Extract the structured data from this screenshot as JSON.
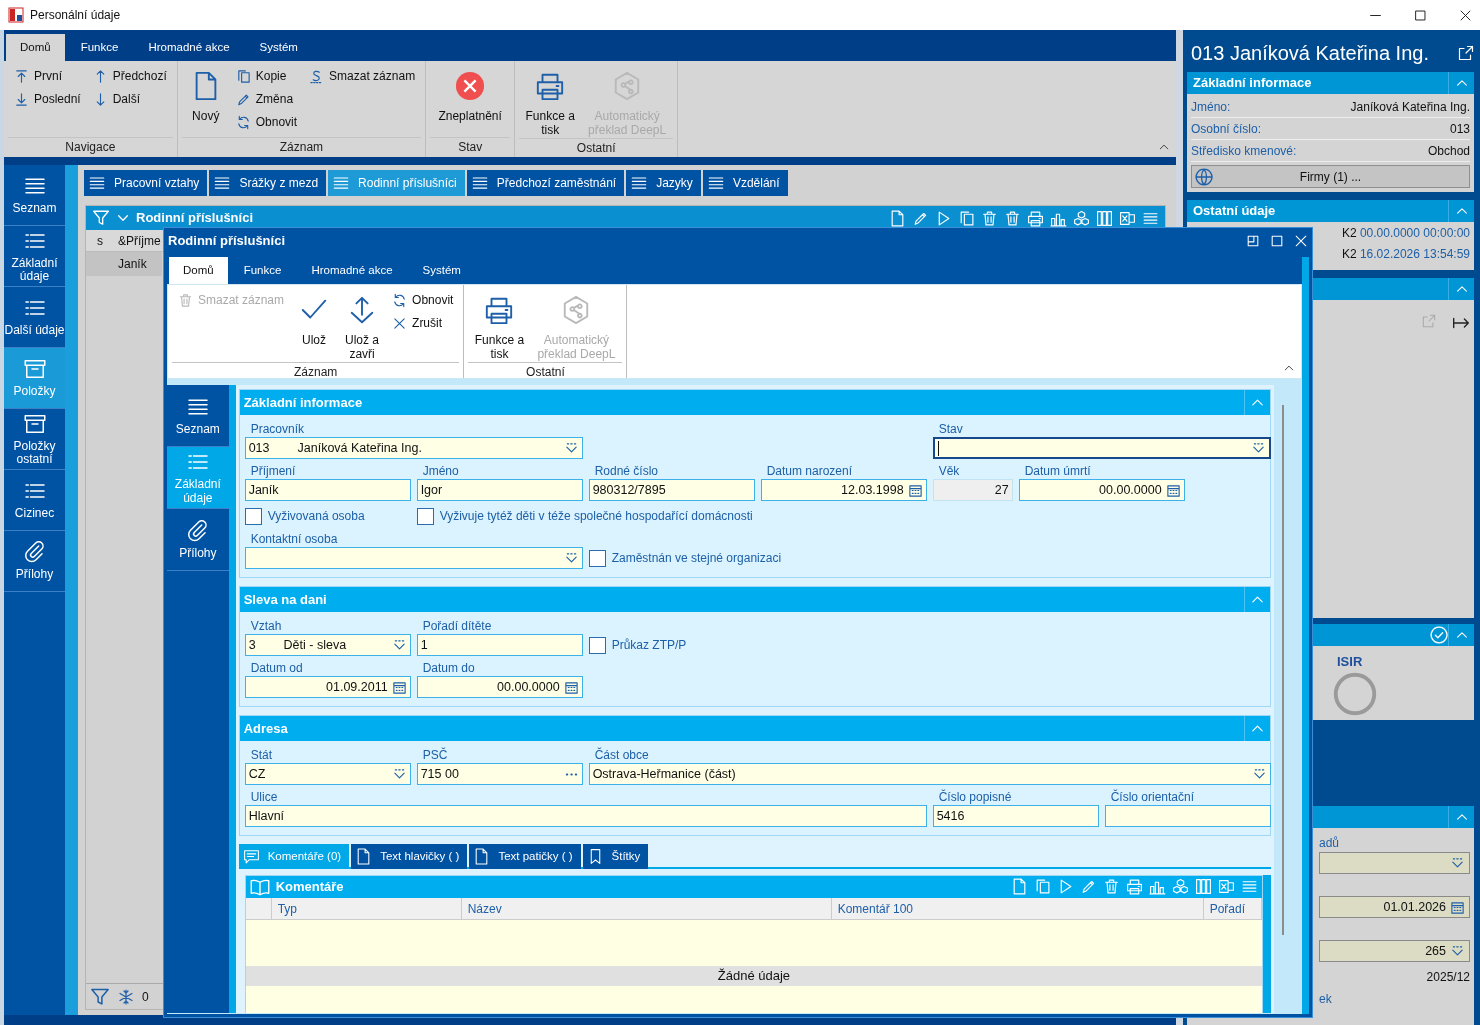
{
  "window": {
    "title": "Personální údaje"
  },
  "ribbon": {
    "tabs": [
      {
        "label": "Domů",
        "selected": true
      },
      {
        "label": "Funkce",
        "selected": false
      },
      {
        "label": "Hromadné akce",
        "selected": false
      },
      {
        "label": "Systém",
        "selected": false
      }
    ],
    "groups": [
      {
        "label": "Navigace",
        "columns": [
          [
            {
              "label": "První",
              "kind": "small",
              "disabled": false
            },
            {
              "label": "Poslední",
              "kind": "small",
              "disabled": false
            }
          ],
          [
            {
              "label": "Předchozí",
              "kind": "small",
              "disabled": false
            },
            {
              "label": "Další",
              "kind": "small",
              "disabled": false
            }
          ]
        ]
      },
      {
        "label": "Záznam",
        "columns": [
          [
            {
              "label": "Nový",
              "kind": "large",
              "disabled": false
            }
          ],
          [
            {
              "label": "Kopie",
              "kind": "small",
              "disabled": false
            },
            {
              "label": "Změna",
              "kind": "small",
              "disabled": false
            },
            {
              "label": "Obnovit",
              "kind": "small",
              "disabled": false
            }
          ],
          [
            {
              "label": "Smazat záznam",
              "kind": "small",
              "disabled": false
            }
          ]
        ]
      },
      {
        "label": "Stav",
        "columns": [
          [
            {
              "label": "Zneplatnění",
              "kind": "large",
              "disabled": false
            }
          ]
        ]
      },
      {
        "label": "Ostatní",
        "columns": [
          [
            {
              "label": "Funkce a tisk",
              "kind": "large",
              "disabled": false
            }
          ],
          [
            {
              "label": "Automatický překlad DeepL",
              "kind": "large",
              "disabled": true
            }
          ]
        ]
      }
    ]
  },
  "sidebar": {
    "items": [
      {
        "label": "Seznam",
        "selected": false
      },
      {
        "label": "Základní údaje",
        "selected": false
      },
      {
        "label": "Další údaje",
        "selected": false
      },
      {
        "label": "Položky",
        "selected": true
      },
      {
        "label": "Položky ostatní",
        "selected": false
      },
      {
        "label": "Cizinec",
        "selected": false
      },
      {
        "label": "Přílohy",
        "selected": false
      }
    ]
  },
  "tabs": [
    {
      "label": "Pracovní vztahy",
      "selected": false
    },
    {
      "label": "Srážky z mezd",
      "selected": false
    },
    {
      "label": "Rodinní příslušníci",
      "selected": true
    },
    {
      "label": "Předchozí zaměstnání",
      "selected": false
    },
    {
      "label": "Jazyky",
      "selected": false
    },
    {
      "label": "Vzdělání",
      "selected": false
    }
  ],
  "list": {
    "title": "Rodinní příslušníci",
    "columns": [
      "s",
      "&Příjme"
    ],
    "rows": [
      {
        "name": "Janík",
        "selected": true
      }
    ],
    "count": "0"
  },
  "detail": {
    "title": "013 Janíková Kateřina Ing.",
    "sections": [
      {
        "kind": "info",
        "title": "Základní informace",
        "rows": [
          {
            "label": "Jméno:",
            "value": "Janíková Kateřina Ing."
          },
          {
            "label": "Osobní číslo:",
            "value": "013"
          },
          {
            "label": "Středisko kmenové:",
            "value": "Obchod"
          }
        ],
        "button": "Firmy (1) ..."
      },
      {
        "kind": "stamps",
        "title": "Ostatní údaje",
        "rows": [
          {
            "code": "K2",
            "value": "00.00.0000 00:00:00"
          },
          {
            "code": "K2",
            "value": "16.02.2026 13:54:59"
          }
        ]
      },
      {
        "kind": "links"
      },
      {
        "kind": "isir",
        "label": "ISIR"
      },
      {
        "kind": "fields",
        "items": [
          {
            "kind": "label",
            "text": "adů"
          },
          {
            "kind": "combo"
          },
          {
            "kind": "date",
            "text": "01.01.2026"
          },
          {
            "kind": "combo",
            "text": "265"
          },
          {
            "kind": "text",
            "text": "2025/12"
          },
          {
            "kind": "label",
            "text": "ek"
          }
        ]
      }
    ]
  },
  "dialog": {
    "title": "Rodinní příslušníci",
    "ribbon": {
      "tabs": [
        {
          "label": "Domů",
          "selected": true
        },
        {
          "label": "Funkce",
          "selected": false
        },
        {
          "label": "Hromadné akce",
          "selected": false
        },
        {
          "label": "Systém",
          "selected": false
        }
      ],
      "groups": [
        {
          "label": "Záznam",
          "columns": [
            [
              {
                "label": "Smazat záznam",
                "kind": "small",
                "disabled": true
              }
            ],
            [
              {
                "label": "Ulož",
                "kind": "large",
                "disabled": false
              }
            ],
            [
              {
                "label": "Ulož a zavři",
                "kind": "large",
                "disabled": false
              }
            ],
            [
              {
                "label": "Obnovit",
                "kind": "small",
                "disabled": false
              },
              {
                "label": "Zrušit",
                "kind": "small",
                "disabled": false
              }
            ]
          ]
        },
        {
          "label": "Ostatní",
          "columns": [
            [
              {
                "label": "Funkce a tisk",
                "kind": "large",
                "disabled": false
              }
            ],
            [
              {
                "label": "Automatický překlad DeepL",
                "kind": "large",
                "disabled": true
              }
            ]
          ]
        }
      ]
    },
    "nav": [
      {
        "label": "Seznam",
        "selected": false
      },
      {
        "label": "Základní údaje",
        "selected": true
      },
      {
        "label": "Přílohy",
        "selected": false
      }
    ],
    "sections": [
      {
        "title": "Základní informace",
        "items": [
          {
            "kind": "combo",
            "label": "Pracovník",
            "code": "013",
            "value": "Janíková Kateřina Ing.",
            "focused": false
          },
          {
            "kind": "combo",
            "label": "Stav",
            "focused": true
          },
          {
            "kind": "text",
            "label": "Příjmení",
            "value": "Janík",
            "focused": false
          },
          {
            "kind": "text",
            "label": "Jméno",
            "value": "Igor",
            "focused": false
          },
          {
            "kind": "text",
            "label": "Rodné číslo",
            "value": "980312/7895",
            "focused": false
          },
          {
            "kind": "date",
            "label": "Datum narození",
            "value": "12.03.1998",
            "focused": false
          },
          {
            "kind": "readonly",
            "label": "Věk",
            "value": "27",
            "focused": false
          },
          {
            "kind": "date",
            "label": "Datum úmrtí",
            "value": "00.00.0000",
            "focused": false
          },
          {
            "kind": "checkbox",
            "label": "Vyživovaná osoba",
            "checked": false
          },
          {
            "kind": "checkbox",
            "label": "Vyživuje tytéž děti v téže společné hospodařící domácnosti",
            "checked": false
          },
          {
            "kind": "combo",
            "label": "Kontaktní osoba",
            "focused": false
          },
          {
            "kind": "checkbox",
            "label": "Zaměstnán ve stejné organizaci",
            "checked": false
          }
        ]
      },
      {
        "title": "Sleva na dani",
        "items": [
          {
            "kind": "combo",
            "label": "Vztah",
            "code": "3",
            "value": "Děti - sleva",
            "focused": false
          },
          {
            "kind": "number",
            "label": "Pořadí dítěte",
            "value": "1",
            "focused": false
          },
          {
            "kind": "checkbox",
            "label": "Průkaz ZTP/P",
            "checked": false
          },
          {
            "kind": "date",
            "label": "Datum od",
            "value": "01.09.2011",
            "focused": false
          },
          {
            "kind": "date",
            "label": "Datum do",
            "value": "00.00.0000",
            "focused": false
          }
        ]
      },
      {
        "title": "Adresa",
        "items": [
          {
            "kind": "combo",
            "label": "Stát",
            "code": "CZ",
            "focused": false
          },
          {
            "kind": "lookup",
            "label": "PSČ",
            "value": "715 00",
            "focused": false
          },
          {
            "kind": "combo",
            "label": "Část obce",
            "code": "Ostrava-Heřmanice (část)",
            "focused": false
          },
          {
            "kind": "text",
            "label": "Ulice",
            "value": "Hlavní",
            "focused": false
          },
          {
            "kind": "text",
            "label": "Číslo popisné",
            "value": "5416",
            "focused": false
          },
          {
            "kind": "text",
            "label": "Číslo orientační",
            "focused": false
          }
        ]
      }
    ],
    "bottom_tabs": [
      {
        "label": "Komentáře (0)",
        "selected": true
      },
      {
        "label": "Text hlavičky ( )",
        "selected": false
      },
      {
        "label": "Text patičky ( )",
        "selected": false
      },
      {
        "label": "Štítky",
        "selected": false
      }
    ],
    "comments": {
      "title": "Komentáře",
      "columns": [
        "Typ",
        "Název",
        "Komentář 100",
        "Pořadí"
      ],
      "empty_text": "Žádné údaje"
    }
  }
}
